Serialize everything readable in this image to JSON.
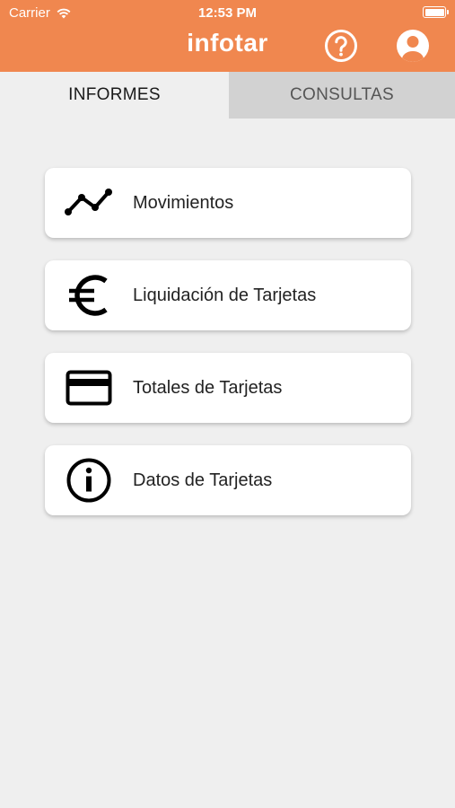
{
  "status_bar": {
    "carrier": "Carrier",
    "time": "12:53 PM"
  },
  "header": {
    "title": "infotar",
    "background_color": "#f0874f",
    "help_icon": "question-circle-icon",
    "profile_icon": "user-circle-icon"
  },
  "tabs": [
    {
      "label": "INFORMES",
      "active": true
    },
    {
      "label": "CONSULTAS",
      "active": false
    }
  ],
  "menu": {
    "items": [
      {
        "label": "Movimientos",
        "icon": "line-chart-icon"
      },
      {
        "label": "Liquidación de Tarjetas",
        "icon": "euro-icon"
      },
      {
        "label": "Totales de Tarjetas",
        "icon": "credit-card-icon"
      },
      {
        "label": "Datos de Tarjetas",
        "icon": "info-icon"
      }
    ]
  }
}
